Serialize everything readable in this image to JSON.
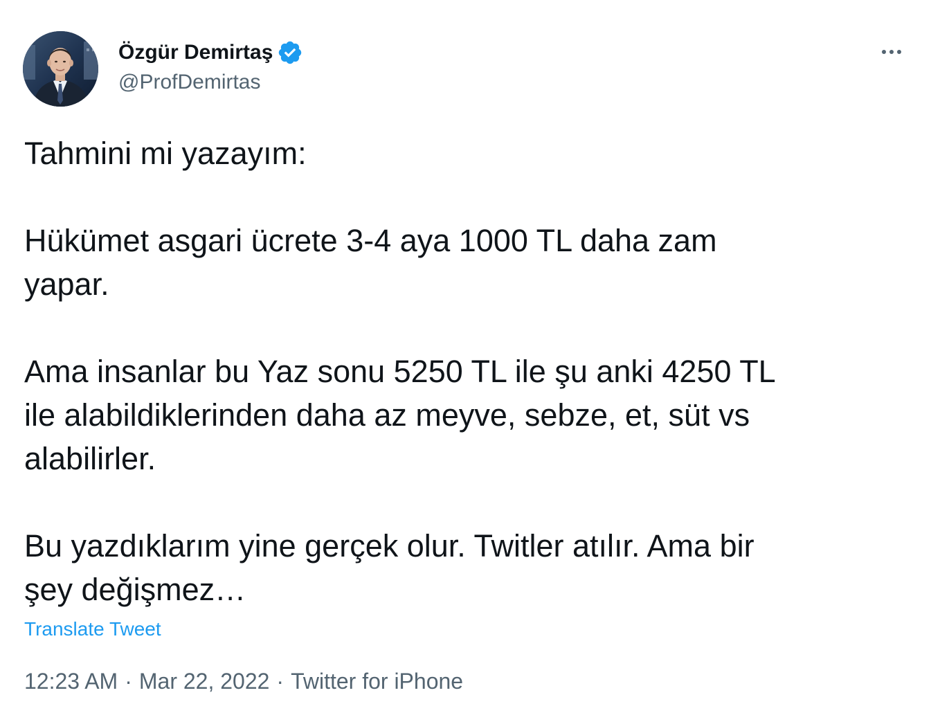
{
  "author": {
    "display_name": "Özgür Demirtaş",
    "handle": "@ProfDemirtas",
    "verified": true
  },
  "tweet": {
    "text": "Tahmini mi yazayım:\n\nHükümet asgari ücrete 3-4 aya 1000 TL daha zam\nyapar.\n\nAma insanlar bu Yaz sonu 5250 TL ile şu anki 4250 TL\nile alabildiklerinden daha az meyve, sebze, et, süt vs\nalabilirler.\n\nBu yazdıklarım yine gerçek olur. Twitler atılır. Ama bir\nşey değişmez…",
    "translate_label": "Translate Tweet"
  },
  "meta": {
    "time": "12:23 AM",
    "separator": "·",
    "date": "Mar 22, 2022",
    "source": "Twitter for iPhone"
  },
  "icons": {
    "more": "more-icon",
    "verified": "verified-badge-icon"
  },
  "colors": {
    "text": "#0f1419",
    "secondary": "#536471",
    "link": "#1d9bf0",
    "verified": "#1d9bf0"
  }
}
